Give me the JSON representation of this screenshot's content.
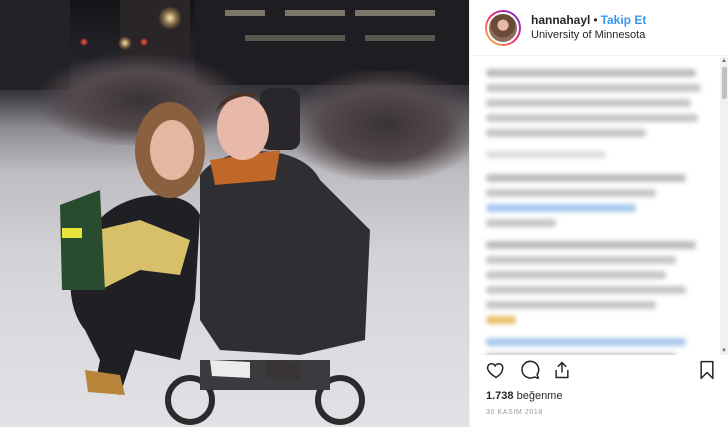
{
  "post": {
    "username": "hannahayl",
    "separator": "•",
    "follow_label": "Takip Et",
    "location": "University of Minnesota",
    "likes_count": "1.738",
    "likes_label": "beğenme",
    "date": "30 KASIM 2018"
  },
  "icons": {
    "like": "heart-icon",
    "comment": "comment-icon",
    "share": "share-icon",
    "save": "bookmark-icon"
  },
  "colors": {
    "follow": "#3897f0",
    "text": "#262626",
    "muted": "#999999",
    "like_heart": "#ed4956"
  }
}
